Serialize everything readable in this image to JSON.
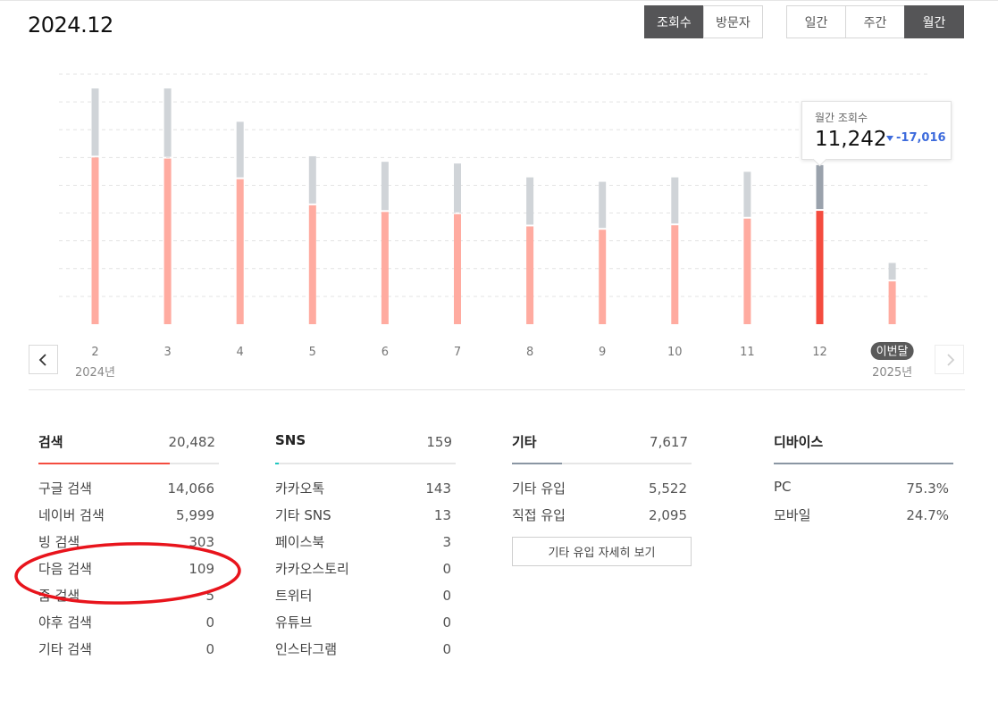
{
  "page": {
    "title": "2024.12"
  },
  "metric_toggle": {
    "views": "조회수",
    "visitors": "방문자",
    "active": "views"
  },
  "period_toggle": {
    "daily": "일간",
    "weekly": "주간",
    "monthly": "월간",
    "active": "monthly"
  },
  "tooltip": {
    "label": "월간 조회수",
    "value": "11,242",
    "delta": "-17,016",
    "delta_icon": "triangle-down-icon",
    "delta_color": "#3d6bdc"
  },
  "chart_data": {
    "type": "bar",
    "stacked": true,
    "categories": [
      "2",
      "3",
      "4",
      "5",
      "6",
      "7",
      "8",
      "9",
      "10",
      "11",
      "12",
      "이번달"
    ],
    "year_labels": [
      {
        "at": "2",
        "label": "2024년"
      },
      {
        "at": "이번달",
        "label": "2025년"
      }
    ],
    "current_badge": "이번달",
    "selected": "12",
    "series": [
      {
        "role": "search",
        "color": "#ffaba0",
        "selected_color": "#f44c3f",
        "values": [
          30000,
          29800,
          26100,
          21400,
          20200,
          19800,
          17600,
          17000,
          17800,
          19000,
          20400,
          7700
        ]
      },
      {
        "role": "other",
        "color": "#d0d4d8",
        "selected_color": "#9aa2ac",
        "values": [
          12100,
          12300,
          10000,
          8500,
          8700,
          8800,
          8500,
          8300,
          8300,
          8100,
          7900,
          3000
        ]
      }
    ],
    "ylim": [
      0,
      45000
    ],
    "grid": true,
    "legend": "none"
  },
  "panels": [
    {
      "name": "검색",
      "total": "20,482",
      "share": 0.73,
      "color": "#f44c3f",
      "rows": [
        {
          "label": "구글 검색",
          "value": "14,066"
        },
        {
          "label": "네이버 검색",
          "value": "5,999"
        },
        {
          "label": "빙 검색",
          "value": "303"
        },
        {
          "label": "다음 검색",
          "value": "109"
        },
        {
          "label": "줌 검색",
          "value": "5"
        },
        {
          "label": "야후 검색",
          "value": "0"
        },
        {
          "label": "기타 검색",
          "value": "0"
        }
      ]
    },
    {
      "name": "SNS",
      "total": "159",
      "share": 0.02,
      "color": "#1fc7c0",
      "rows": [
        {
          "label": "카카오톡",
          "value": "143"
        },
        {
          "label": "기타 SNS",
          "value": "13"
        },
        {
          "label": "페이스북",
          "value": "3"
        },
        {
          "label": "카카오스토리",
          "value": "0"
        },
        {
          "label": "트위터",
          "value": "0"
        },
        {
          "label": "유튜브",
          "value": "0"
        },
        {
          "label": "인스타그램",
          "value": "0"
        }
      ]
    },
    {
      "name": "기타",
      "total": "7,617",
      "share": 0.28,
      "color": "#8a96a3",
      "rows": [
        {
          "label": "기타 유입",
          "value": "5,522"
        },
        {
          "label": "직접 유입",
          "value": "2,095"
        }
      ],
      "button": "기타 유입 자세히 보기"
    },
    {
      "name": "디바이스",
      "total": "",
      "share": 1.0,
      "color": "#8a96a3",
      "rows": [
        {
          "label": "PC",
          "value": "75.3%"
        },
        {
          "label": "모바일",
          "value": "24.7%"
        }
      ]
    }
  ],
  "annotation": {
    "color": "#e8141c"
  }
}
